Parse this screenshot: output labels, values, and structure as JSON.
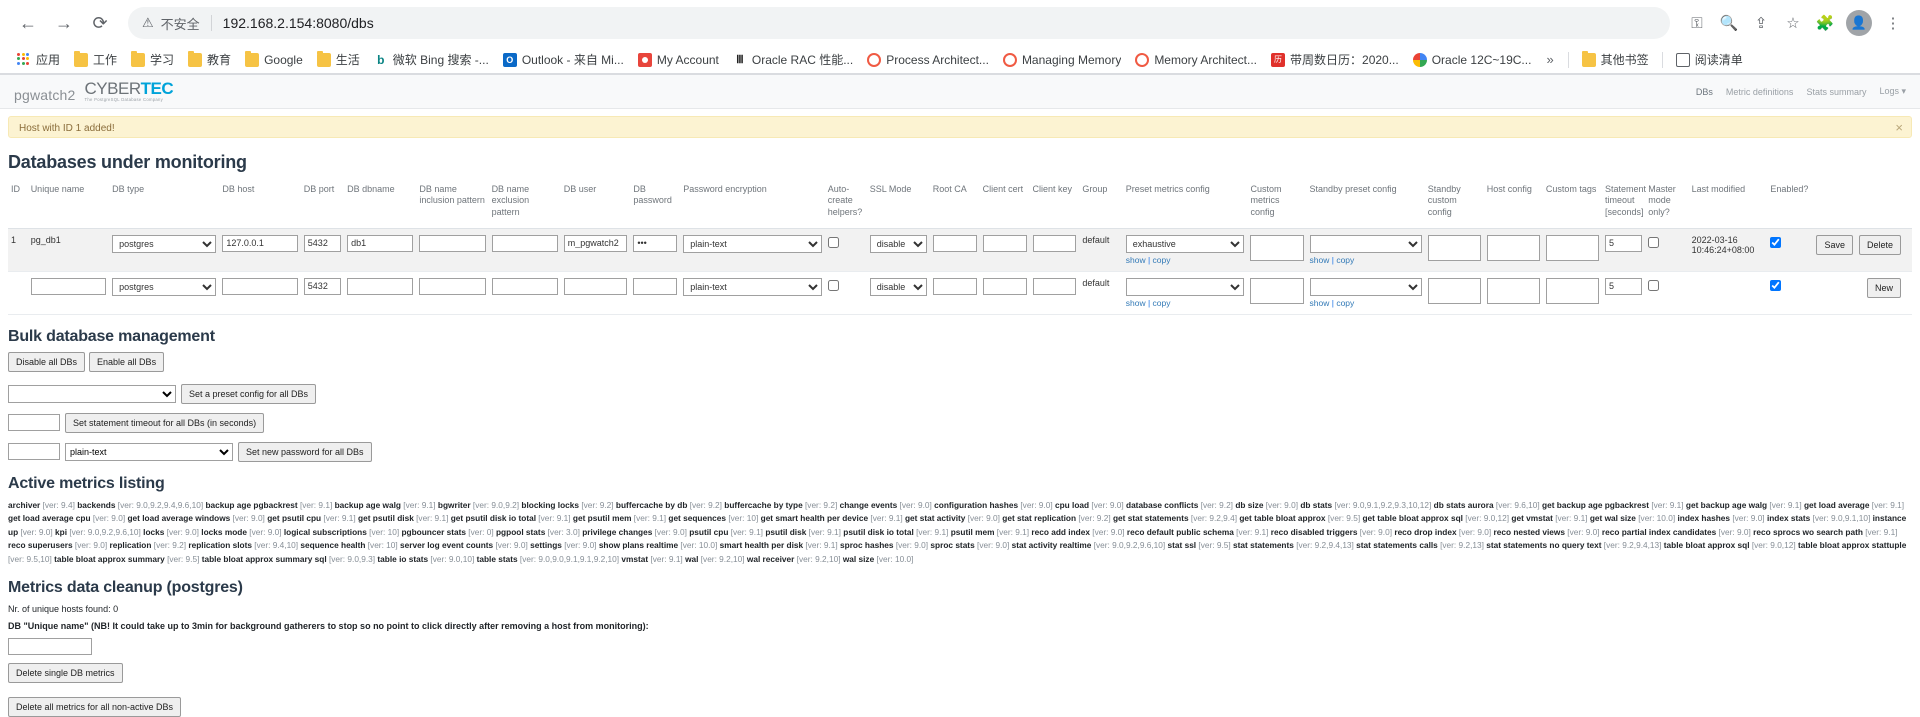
{
  "browser": {
    "back_icon": "back-arrow-icon",
    "forward_icon": "forward-arrow-icon",
    "reload_icon": "reload-icon",
    "security_label": "不安全",
    "url": "192.168.2.154:8080/dbs",
    "key_icon": "key-icon",
    "search_icon": "search-icon",
    "share_icon": "share-icon",
    "star_icon": "star-icon",
    "extensions_icon": "extensions-icon",
    "profile_icon": "profile-icon",
    "menu_icon": "three-dot-menu-icon",
    "bookmarks": [
      {
        "label": "应用",
        "icon": "apps-grid-icon"
      },
      {
        "label": "工作",
        "icon": "folder-icon"
      },
      {
        "label": "学习",
        "icon": "folder-icon"
      },
      {
        "label": "教育",
        "icon": "folder-icon"
      },
      {
        "label": "Google",
        "icon": "folder-icon"
      },
      {
        "label": "生活",
        "icon": "folder-icon"
      },
      {
        "label": "微软 Bing 搜索 -...",
        "icon": "bing-icon"
      },
      {
        "label": "Outlook - 来自 Mi...",
        "icon": "outlook-icon"
      },
      {
        "label": "My Account",
        "icon": "red-circle-icon"
      },
      {
        "label": "Oracle RAC 性能...",
        "icon": "oracle-icon"
      },
      {
        "label": "Process Architect...",
        "icon": "ring-icon"
      },
      {
        "label": "Managing Memory",
        "icon": "ring-icon"
      },
      {
        "label": "Memory Architect...",
        "icon": "ring-icon"
      },
      {
        "label": "带周数日历：2020...",
        "icon": "calendar-icon"
      },
      {
        "label": "Oracle 12C~19C...",
        "icon": "google-icon"
      }
    ],
    "overflow_label": "»",
    "other_bookmarks": {
      "label": "其他书签",
      "icon": "folder-icon"
    },
    "reading_list": {
      "label": "阅读清单",
      "icon": "reading-list-icon"
    }
  },
  "app": {
    "brand_pgwatch": "pgwatch2",
    "brand_cyber": "CYBER",
    "brand_tec": "TEC",
    "brand_tagline": "The PostgreSQL Database Company",
    "nav": [
      {
        "label": "DBs",
        "active": true
      },
      {
        "label": "Metric definitions",
        "active": false
      },
      {
        "label": "Stats summary",
        "active": false
      },
      {
        "label": "Logs ▾",
        "active": false
      }
    ]
  },
  "alert": {
    "message": "Host with ID 1 added!",
    "close_icon": "close-icon"
  },
  "databases": {
    "heading": "Databases under monitoring",
    "columns": [
      "ID",
      "Unique name",
      "DB type",
      "DB host",
      "DB port",
      "DB dbname",
      "DB name inclusion pattern",
      "DB name exclusion pattern",
      "DB user",
      "DB password",
      "Password encryption",
      "Auto-create helpers?",
      "SSL Mode",
      "Root CA",
      "Client cert",
      "Client key",
      "Group",
      "Preset metrics config",
      "Custom metrics config",
      "Standby preset config",
      "Standby custom config",
      "Host config",
      "Custom tags",
      "Statement timeout [seconds]",
      "Master mode only?",
      "Last modified",
      "Enabled?"
    ],
    "rows": [
      {
        "id": "1",
        "unique_name": "pg_db1",
        "db_type": "postgres",
        "db_host": "127.0.0.1",
        "db_port": "5432",
        "db_dbname": "db1",
        "db_name_inclusion": "",
        "db_name_exclusion": "",
        "db_user": "m_pgwatch2",
        "db_password": "•••",
        "password_encryption": "plain-text",
        "auto_create_helpers": false,
        "ssl_mode": "disable",
        "root_ca": "",
        "client_cert": "",
        "client_key": "",
        "group": "default",
        "preset_metrics_config": "exhaustive",
        "preset_show": "show",
        "preset_copy": "copy",
        "custom_metrics_config": "",
        "standby_preset_config": "",
        "standby_show": "show",
        "standby_copy": "copy",
        "standby_custom_config": "",
        "host_config": "",
        "custom_tags": "",
        "statement_timeout": "5",
        "master_mode_only": false,
        "last_modified": "2022-03-16 10:46:24+08:00",
        "enabled": true,
        "save_label": "Save",
        "delete_label": "Delete"
      }
    ],
    "new_row": {
      "id": "",
      "unique_name": "",
      "db_type": "postgres",
      "db_host": "",
      "db_port": "5432",
      "db_dbname": "",
      "db_name_inclusion": "",
      "db_name_exclusion": "",
      "db_user": "",
      "db_password": "",
      "password_encryption": "plain-text",
      "auto_create_helpers": false,
      "ssl_mode": "disable",
      "root_ca": "",
      "client_cert": "",
      "client_key": "",
      "group": "default",
      "preset_metrics_config": "",
      "preset_show": "show",
      "preset_copy": "copy",
      "custom_metrics_config": "",
      "standby_preset_config": "",
      "standby_show": "show",
      "standby_copy": "copy",
      "standby_custom_config": "",
      "host_config": "",
      "custom_tags": "",
      "statement_timeout": "5",
      "master_mode_only": false,
      "last_modified": "",
      "enabled": true,
      "new_label": "New"
    }
  },
  "bulk": {
    "heading": "Bulk database management",
    "disable_all_label": "Disable all DBs",
    "enable_all_label": "Enable all DBs",
    "preset_select_value": "",
    "set_preset_label": "Set a preset config for all DBs",
    "timeout_value": "",
    "set_timeout_label": "Set statement timeout for all DBs (in seconds)",
    "password_value": "",
    "password_encryption": "plain-text",
    "set_password_label": "Set new password for all DBs"
  },
  "metrics": {
    "heading": "Active metrics listing",
    "items": [
      {
        "name": "archiver",
        "ver": "[ver: 9.4]"
      },
      {
        "name": "backends",
        "ver": "[ver: 9.0,9.2,9.4,9.6,10]"
      },
      {
        "name": "backup age pgbackrest",
        "ver": "[ver: 9.1]"
      },
      {
        "name": "backup age walg",
        "ver": "[ver: 9.1]"
      },
      {
        "name": "bgwriter",
        "ver": "[ver: 9.0,9.2]"
      },
      {
        "name": "blocking locks",
        "ver": "[ver: 9.2]"
      },
      {
        "name": "buffercache by db",
        "ver": "[ver: 9.2]"
      },
      {
        "name": "buffercache by type",
        "ver": "[ver: 9.2]"
      },
      {
        "name": "change events",
        "ver": "[ver: 9.0]"
      },
      {
        "name": "configuration hashes",
        "ver": "[ver: 9.0]"
      },
      {
        "name": "cpu load",
        "ver": "[ver: 9.0]"
      },
      {
        "name": "database conflicts",
        "ver": "[ver: 9.2]"
      },
      {
        "name": "db size",
        "ver": "[ver: 9.0]"
      },
      {
        "name": "db stats",
        "ver": "[ver: 9.0,9.1,9.2,9.3,10,12]"
      },
      {
        "name": "db stats aurora",
        "ver": "[ver: 9.6,10]"
      },
      {
        "name": "get backup age pgbackrest",
        "ver": "[ver: 9.1]"
      },
      {
        "name": "get backup age walg",
        "ver": "[ver: 9.1]"
      },
      {
        "name": "get load average",
        "ver": "[ver: 9.1]"
      },
      {
        "name": "get load average cpu",
        "ver": "[ver: 9.0]"
      },
      {
        "name": "get load average windows",
        "ver": "[ver: 9.0]"
      },
      {
        "name": "get psutil cpu",
        "ver": "[ver: 9.1]"
      },
      {
        "name": "get psutil disk",
        "ver": "[ver: 9.1]"
      },
      {
        "name": "get psutil disk io total",
        "ver": "[ver: 9.1]"
      },
      {
        "name": "get psutil mem",
        "ver": "[ver: 9.1]"
      },
      {
        "name": "get sequences",
        "ver": "[ver: 10]"
      },
      {
        "name": "get smart health per device",
        "ver": "[ver: 9.1]"
      },
      {
        "name": "get stat activity",
        "ver": "[ver: 9.0]"
      },
      {
        "name": "get stat replication",
        "ver": "[ver: 9.2]"
      },
      {
        "name": "get stat statements",
        "ver": "[ver: 9.2,9.4]"
      },
      {
        "name": "get table bloat approx",
        "ver": "[ver: 9.5]"
      },
      {
        "name": "get table bloat approx sql",
        "ver": "[ver: 9.0,12]"
      },
      {
        "name": "get vmstat",
        "ver": "[ver: 9.1]"
      },
      {
        "name": "get wal size",
        "ver": "[ver: 10.0]"
      },
      {
        "name": "index hashes",
        "ver": "[ver: 9.0]"
      },
      {
        "name": "index stats",
        "ver": "[ver: 9.0,9.1,10]"
      },
      {
        "name": "instance up",
        "ver": "[ver: 9.0]"
      },
      {
        "name": "kpi",
        "ver": "[ver: 9.0,9.2,9.6,10]"
      },
      {
        "name": "locks",
        "ver": "[ver: 9.0]"
      },
      {
        "name": "locks mode",
        "ver": "[ver: 9.0]"
      },
      {
        "name": "logical subscriptions",
        "ver": "[ver: 10]"
      },
      {
        "name": "pgbouncer stats",
        "ver": "[ver: 0]"
      },
      {
        "name": "pgpool stats",
        "ver": "[ver: 3.0]"
      },
      {
        "name": "privilege changes",
        "ver": "[ver: 9.0]"
      },
      {
        "name": "psutil cpu",
        "ver": "[ver: 9.1]"
      },
      {
        "name": "psutil disk",
        "ver": "[ver: 9.1]"
      },
      {
        "name": "psutil disk io total",
        "ver": "[ver: 9.1]"
      },
      {
        "name": "psutil mem",
        "ver": "[ver: 9.1]"
      },
      {
        "name": "reco add index",
        "ver": "[ver: 9.0]"
      },
      {
        "name": "reco default public schema",
        "ver": "[ver: 9.1]"
      },
      {
        "name": "reco disabled triggers",
        "ver": "[ver: 9.0]"
      },
      {
        "name": "reco drop index",
        "ver": "[ver: 9.0]"
      },
      {
        "name": "reco nested views",
        "ver": "[ver: 9.0]"
      },
      {
        "name": "reco partial index candidates",
        "ver": "[ver: 9.0]"
      },
      {
        "name": "reco sprocs wo search path",
        "ver": "[ver: 9.1]"
      },
      {
        "name": "reco superusers",
        "ver": "[ver: 9.0]"
      },
      {
        "name": "replication",
        "ver": "[ver: 9.2]"
      },
      {
        "name": "replication slots",
        "ver": "[ver: 9.4,10]"
      },
      {
        "name": "sequence health",
        "ver": "[ver: 10]"
      },
      {
        "name": "server log event counts",
        "ver": "[ver: 9.0]"
      },
      {
        "name": "settings",
        "ver": "[ver: 9.0]"
      },
      {
        "name": "show plans realtime",
        "ver": "[ver: 10.0]"
      },
      {
        "name": "smart health per disk",
        "ver": "[ver: 9.1]"
      },
      {
        "name": "sproc hashes",
        "ver": "[ver: 9.0]"
      },
      {
        "name": "sproc stats",
        "ver": "[ver: 9.0]"
      },
      {
        "name": "stat activity realtime",
        "ver": "[ver: 9.0,9.2,9.6,10]"
      },
      {
        "name": "stat ssl",
        "ver": "[ver: 9.5]"
      },
      {
        "name": "stat statements",
        "ver": "[ver: 9.2,9.4,13]"
      },
      {
        "name": "stat statements calls",
        "ver": "[ver: 9.2,13]"
      },
      {
        "name": "stat statements no query text",
        "ver": "[ver: 9.2,9.4,13]"
      },
      {
        "name": "table bloat approx sql",
        "ver": "[ver: 9.0,12]"
      },
      {
        "name": "table bloat approx stattuple",
        "ver": "[ver: 9.5,10]"
      },
      {
        "name": "table bloat approx summary",
        "ver": "[ver: 9.5]"
      },
      {
        "name": "table bloat approx summary sql",
        "ver": "[ver: 9.0,9.3]"
      },
      {
        "name": "table io stats",
        "ver": "[ver: 9.0,10]"
      },
      {
        "name": "table stats",
        "ver": "[ver: 9.0,9.0,9.1,9.1,9.2,10]"
      },
      {
        "name": "vmstat",
        "ver": "[ver: 9.1]"
      },
      {
        "name": "wal",
        "ver": "[ver: 9.2,10]"
      },
      {
        "name": "wal receiver",
        "ver": "[ver: 9.2,10]"
      },
      {
        "name": "wal size",
        "ver": "[ver: 10.0]"
      }
    ]
  },
  "cleanup": {
    "heading": "Metrics data cleanup (postgres)",
    "unique_hosts_note": "Nr. of unique hosts found: 0",
    "warning_note": "DB \"Unique name\" (NB! It could take up to 3min for background gatherers to stop so no point to click directly after removing a host from monitoring):",
    "input_value": "",
    "delete_single_label": "Delete single DB metrics",
    "delete_all_label": "Delete all metrics for all non-active DBs"
  }
}
